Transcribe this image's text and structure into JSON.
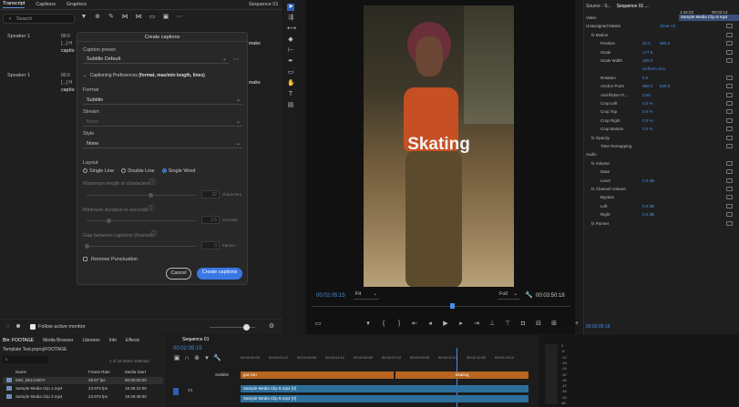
{
  "transcript_panel": {
    "tabs": [
      "Transcript",
      "Captions",
      "Graphics"
    ],
    "sequence_label": "Sequence 01",
    "search_placeholder": "Search",
    "speaker1": "Speaker 1",
    "speaker1_time": "00:0",
    "speaker1_line1": "[...] H",
    "speaker1_line2": "captio",
    "speaker1_suffix": "make",
    "speaker2": "Speaker 1",
    "speaker2_time": "00:0",
    "speaker2_line1": "[...] H",
    "speaker2_line2": "captio",
    "speaker2_suffix": "make",
    "follow_monitor": "Follow active monitor"
  },
  "dialog": {
    "title": "Create captions",
    "caption_preset_label": "Caption preset",
    "caption_preset_value": "Subtitle Default",
    "preferences_title": "Captioning Preferences",
    "preferences_hint": "(format, max/min length, lines)",
    "format_label": "Format",
    "format_value": "Subtitle",
    "stream_label": "Stream",
    "stream_value": "None",
    "style_label": "Style",
    "style_value": "None",
    "layout_label": "Layout",
    "layout_options": [
      "Single Line",
      "Double Line",
      "Single Word"
    ],
    "max_length_label": "Maximum length in characters",
    "max_length_value": "32",
    "max_length_unit": "characters",
    "min_duration_label": "Minimum duration in seconds",
    "min_duration_value": "1.5",
    "min_duration_unit": "seconds",
    "gap_label": "Gap between captions (frames)",
    "gap_value": "0",
    "gap_unit": "frames",
    "remove_punct": "Remove Punctuation",
    "cancel": "Cancel",
    "create": "Create captions"
  },
  "monitor": {
    "caption_overlay": "Skating",
    "timecode_left": "00:02:05:15",
    "fit": "Fit",
    "quality": "Full",
    "timecode_right": "00:03:50:18"
  },
  "effects": {
    "tabs": [
      "Source - S...",
      "Sequence 01 ..."
    ],
    "clip_label": "Sample Media Clip 8.mp4",
    "timecode": "00:02:05:15",
    "ruler_time": "1:44:22",
    "ruler_time2": "00:02:12",
    "rows": [
      {
        "label": "Video",
        "v1": "",
        "v2": ""
      },
      {
        "label": "Unassigned Masks",
        "v1": "",
        "v2": "Clear All"
      },
      {
        "label": "fx  Motion",
        "v1": "",
        "v2": ""
      },
      {
        "label": "Position",
        "v1": "32.0",
        "v2": "960.0"
      },
      {
        "label": "Scale",
        "v1": "177.8",
        "v2": ""
      },
      {
        "label": "Scale Width",
        "v1": "100.0",
        "v2": ""
      },
      {
        "label": "",
        "v1": "Uniform Sca",
        "v2": ""
      },
      {
        "label": "Rotation",
        "v1": "0.0",
        "v2": ""
      },
      {
        "label": "Anchor Point",
        "v1": "960.0",
        "v2": "540.0"
      },
      {
        "label": "Anti-flicker Fi...",
        "v1": "0.00",
        "v2": ""
      },
      {
        "label": "Crop Left",
        "v1": "0.0 %",
        "v2": ""
      },
      {
        "label": "Crop Top",
        "v1": "0.0 %",
        "v2": ""
      },
      {
        "label": "Crop Right",
        "v1": "0.0 %",
        "v2": ""
      },
      {
        "label": "Crop Bottom",
        "v1": "0.0 %",
        "v2": ""
      },
      {
        "label": "fx  Opacity",
        "v1": "",
        "v2": ""
      },
      {
        "label": "Time Remapping",
        "v1": "",
        "v2": ""
      },
      {
        "label": "Audio",
        "v1": "",
        "v2": ""
      },
      {
        "label": "fx  Volume",
        "v1": "",
        "v2": ""
      },
      {
        "label": "Mute",
        "v1": "",
        "v2": ""
      },
      {
        "label": "Level",
        "v1": "0.0 dB",
        "v2": ""
      },
      {
        "label": "fx  Channel Volume",
        "v1": "",
        "v2": ""
      },
      {
        "label": "Bypass",
        "v1": "",
        "v2": ""
      },
      {
        "label": "Left",
        "v1": "0.0 dB",
        "v2": ""
      },
      {
        "label": "Right",
        "v1": "0.0 dB",
        "v2": ""
      },
      {
        "label": "fx  Panner",
        "v1": "",
        "v2": ""
      }
    ]
  },
  "project": {
    "tabs": [
      "Bin: FOOTAGE",
      "Media Browser",
      "Libraries",
      "Info",
      "Effects"
    ],
    "path": "Template Test.prproj\\FOOTAGE",
    "count": "1 of 16 items selected",
    "cols": [
      "Name",
      "Frame Rate",
      "Media Start"
    ],
    "rows": [
      {
        "name": "IMG_9614.MOV",
        "fps": "29.97 fps",
        "start": "00:00:00:00"
      },
      {
        "name": "Sample Media Clip 1.mp4",
        "fps": "23.976 fps",
        "start": "16:35:22:08"
      },
      {
        "name": "Sample Media Clip 2.mp4",
        "fps": "23.976 fps",
        "start": "19:29:48:00"
      }
    ]
  },
  "timeline": {
    "tab": "Sequence 01",
    "timecode": "00:02:05:15",
    "ruler": [
      "00:02:00:00",
      "00:02:01:12",
      "00:02:03:00",
      "00:02:04:12",
      "00:02:06:00",
      "00:02:07:12",
      "00:02:09:00",
      "00:02:10:12",
      "00:02:12:00",
      "00:02:13:12"
    ],
    "subtitle_track": "Subtitle",
    "clip1": "got into",
    "clip2": "Skating",
    "clip3": "Sample Media Clip 8.mp4 [V]",
    "clip4": "Sample Media Clip 8.mp4 [V]"
  },
  "meter": {
    "scale": [
      "0",
      "-6",
      "-12",
      "-18",
      "-24",
      "-30",
      "-36",
      "-42",
      "-48",
      "-54",
      "dB"
    ]
  }
}
